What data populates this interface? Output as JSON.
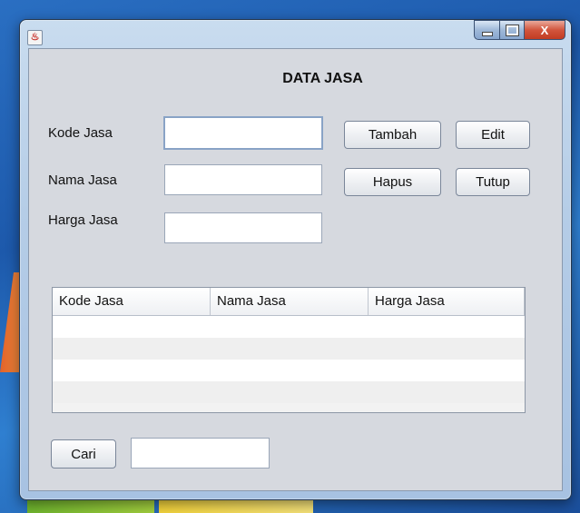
{
  "window": {
    "icon": "java-cup-icon",
    "controls": {
      "minimize": "minimize-icon",
      "maximize": "maximize-icon",
      "close_label": "X"
    }
  },
  "form": {
    "title": "DATA JASA",
    "kode_label": "Kode Jasa",
    "nama_label": "Nama Jasa",
    "harga_label": "Harga Jasa",
    "kode_value": "",
    "nama_value": "",
    "harga_value": ""
  },
  "buttons": {
    "tambah": "Tambah",
    "edit": "Edit",
    "hapus": "Hapus",
    "tutup": "Tutup",
    "cari": "Cari"
  },
  "table": {
    "columns": [
      "Kode Jasa",
      "Nama Jasa",
      "Harga Jasa"
    ],
    "rows": []
  },
  "search": {
    "value": ""
  }
}
